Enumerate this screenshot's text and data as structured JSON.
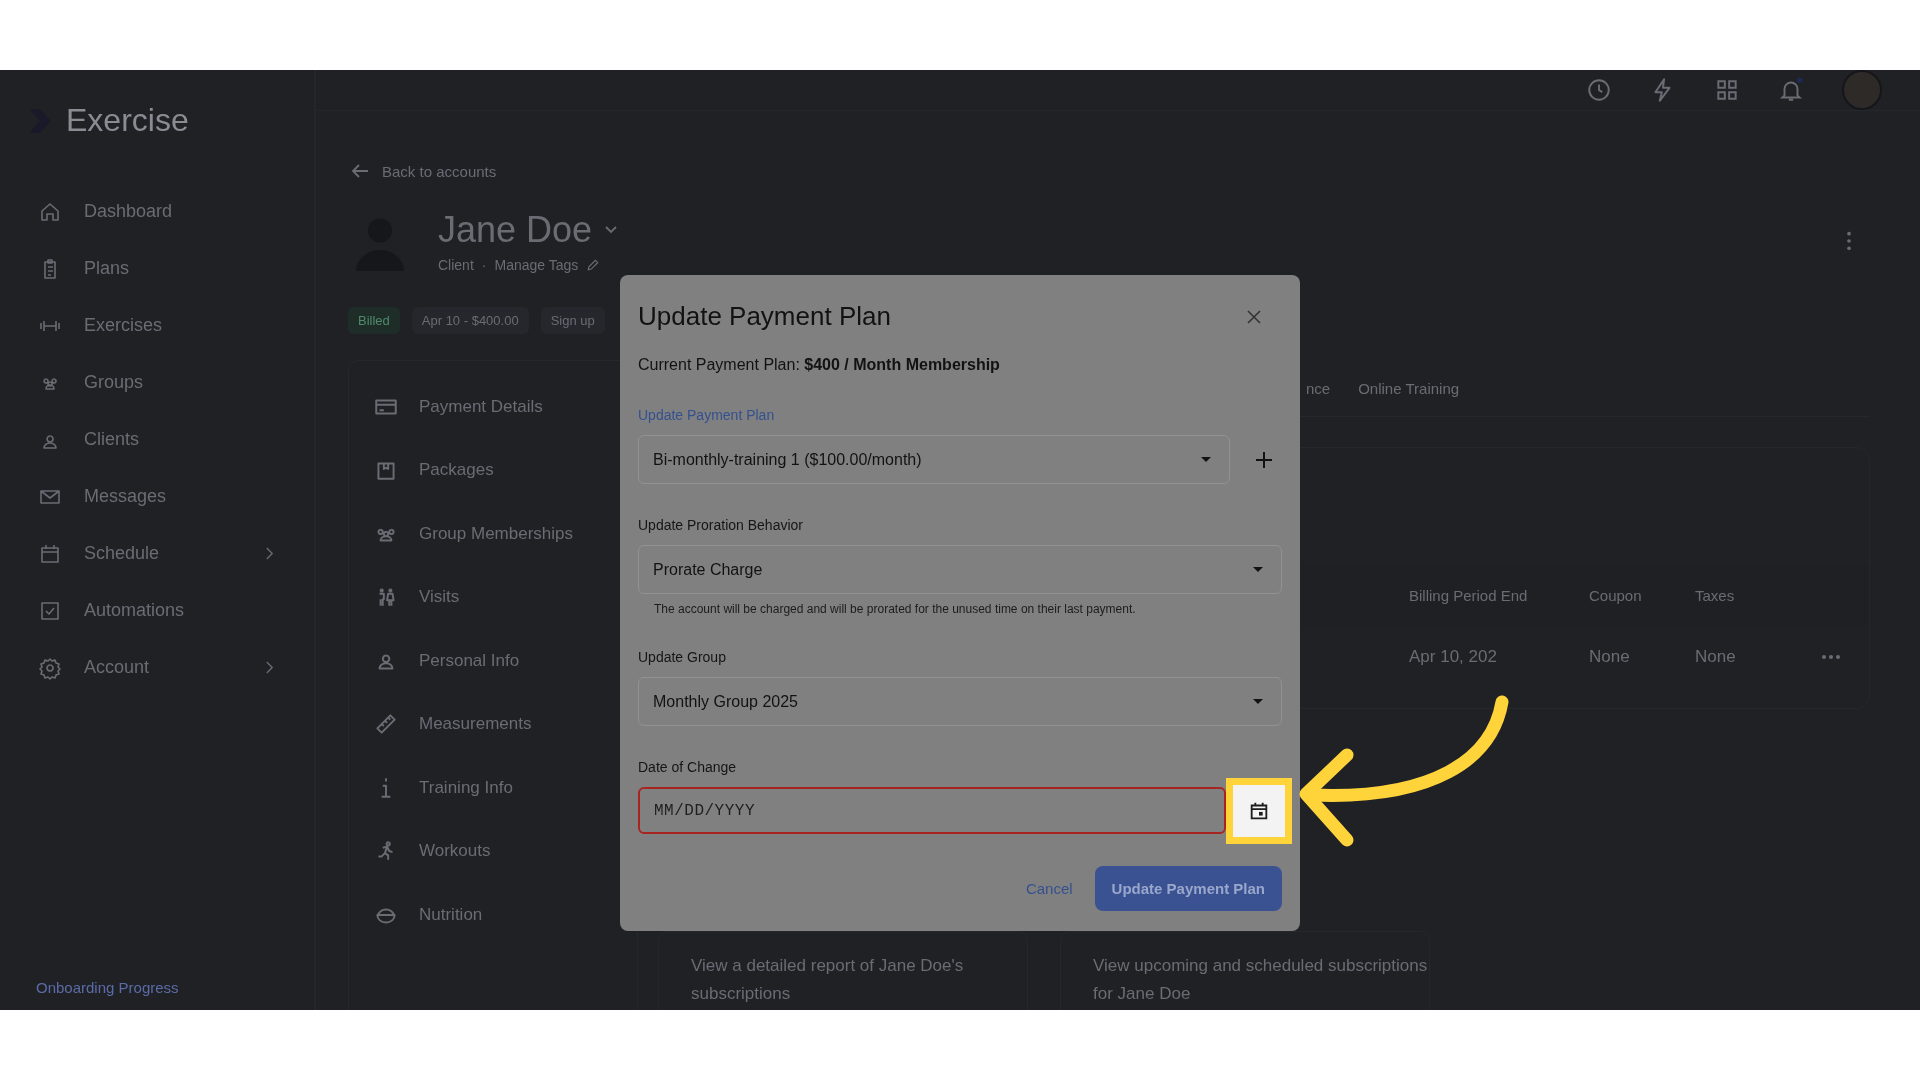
{
  "app": {
    "logo": "Exercise"
  },
  "sidebar": {
    "items": [
      {
        "label": "Dashboard",
        "submenu": false
      },
      {
        "label": "Plans",
        "submenu": false
      },
      {
        "label": "Exercises",
        "submenu": false
      },
      {
        "label": "Groups",
        "submenu": false
      },
      {
        "label": "Clients",
        "submenu": false
      },
      {
        "label": "Messages",
        "submenu": false
      },
      {
        "label": "Schedule",
        "submenu": true
      },
      {
        "label": "Automations",
        "submenu": false
      },
      {
        "label": "Account",
        "submenu": true
      }
    ],
    "footer_link": "Onboarding Progress"
  },
  "profile": {
    "back_link": "Back to accounts",
    "name": "Jane Doe",
    "role": "Client",
    "separator": "·",
    "tags_link": "Manage Tags",
    "badges": [
      {
        "label": "Billed"
      },
      {
        "label": "Apr 10 - $400.00"
      },
      {
        "label": "Sign up"
      }
    ]
  },
  "client_menu": [
    "Payment Details",
    "Packages",
    "Group Memberships",
    "Visits",
    "Personal Info",
    "Measurements",
    "Training Info",
    "Workouts",
    "Nutrition"
  ],
  "tabs": [
    "nce",
    "Online Training"
  ],
  "table": {
    "columns": [
      "Billing Period End",
      "Coupon",
      "Taxes"
    ],
    "rows": [
      [
        "Apr 10, 202",
        "None",
        "None"
      ]
    ]
  },
  "cards": [
    "View a detailed report of Jane Doe's subscriptions",
    "View upcoming and scheduled subscriptions for Jane Doe"
  ],
  "modal": {
    "title": "Update Payment Plan",
    "current_plan": "Current Payment Plan: **$400 / Month Membership**",
    "plan_field": {
      "label": "Update Payment Plan",
      "value": "Bi-monthly-training 1 ($100.00/month)"
    },
    "proration_field": {
      "label": "Update Proration Behavior",
      "value": "Prorate Charge",
      "helper": "The account will be charged and will be prorated for the unused time on their last payment."
    },
    "group_field": {
      "label": "Update Group",
      "value": "Monthly Group 2025"
    },
    "date_field": {
      "label": "Date of Change",
      "placeholder": "MM/DD/YYYY",
      "error": true
    },
    "buttons": {
      "cancel": "Cancel",
      "submit": "Update Payment Plan"
    }
  }
}
